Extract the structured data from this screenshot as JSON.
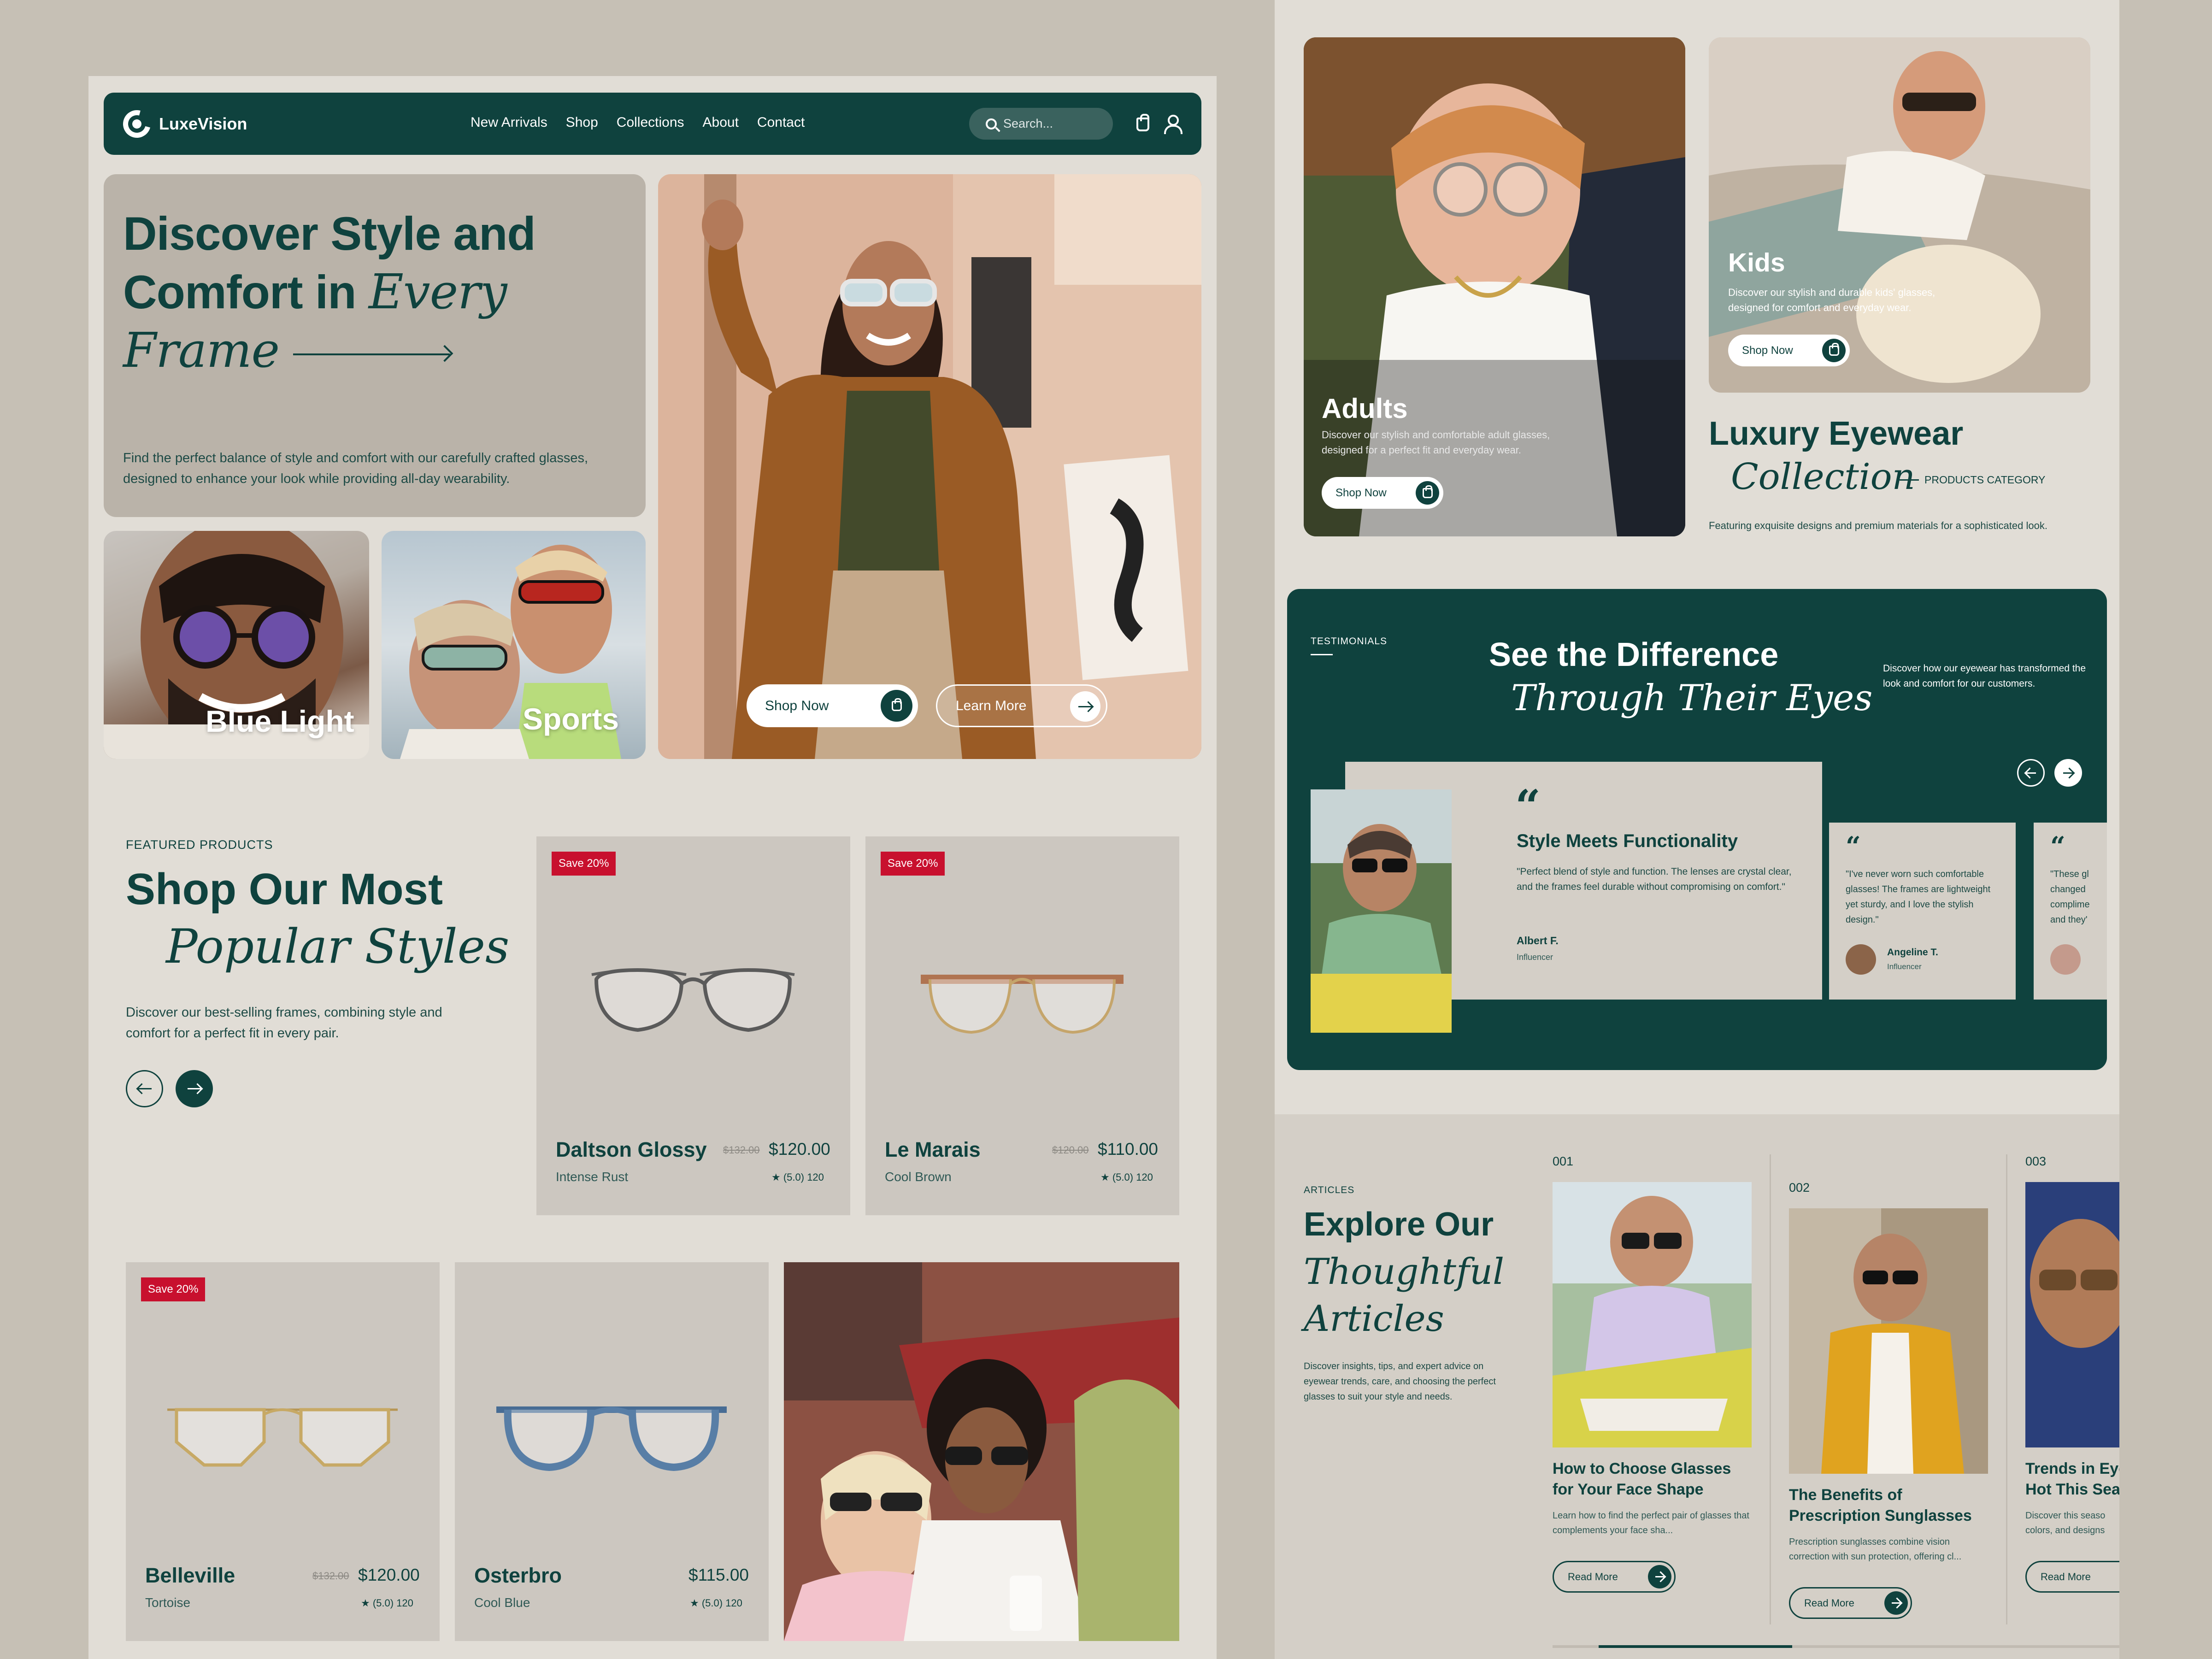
{
  "brand": {
    "name": "LuxeVision"
  },
  "nav": {
    "links": [
      "New Arrivals",
      "Shop",
      "Collections",
      "About",
      "Contact"
    ],
    "search_placeholder": "Search..."
  },
  "hero": {
    "title_line1": "Discover Style and",
    "title_line2_bold": "Comfort in",
    "title_line2_italic": "Every",
    "title_line3_italic": "Frame",
    "description": "Find the perfect balance of style and comfort with our carefully crafted glasses, designed to enhance your look while providing all-day wearability.",
    "shop_now": "Shop Now",
    "learn_more": "Learn More"
  },
  "categories": {
    "blue_light": "Blue Light",
    "sports": "Sports"
  },
  "featured": {
    "eyebrow": "FEATURED PRODUCTS",
    "title_bold": "Shop Our Most",
    "title_italic": "Popular Styles",
    "description": "Discover our best-selling frames, combining style and comfort for a perfect fit in every pair."
  },
  "products": [
    {
      "name": "Daltson Glossy",
      "color": "Intense Rust",
      "old_price": "$132.00",
      "price": "$120.00",
      "rating": "(5.0) 120",
      "badge": "Save 20%"
    },
    {
      "name": "Le Marais",
      "color": "Cool Brown",
      "old_price": "$120.00",
      "price": "$110.00",
      "rating": "(5.0) 120",
      "badge": "Save 20%"
    },
    {
      "name": "Belleville",
      "color": "Tortoise",
      "old_price": "$132.00",
      "price": "$120.00",
      "rating": "(5.0) 120",
      "badge": "Save 20%"
    },
    {
      "name": "Osterbro",
      "color": "Cool Blue",
      "old_price": "",
      "price": "$115.00",
      "rating": "(5.0) 120",
      "badge": ""
    }
  ],
  "audience": {
    "adults": {
      "title": "Adults",
      "desc": "Discover our stylish and comfortable adult glasses, designed for a perfect fit and everyday wear.",
      "cta": "Shop Now"
    },
    "kids": {
      "title": "Kids",
      "desc": "Discover our stylish and durable kids' glasses, designed for comfort and everyday wear.",
      "cta": "Shop Now"
    }
  },
  "luxury": {
    "title_bold": "Luxury Eyewear",
    "title_italic": "Collection",
    "tag": "PRODUCTS CATEGORY",
    "desc": "Featuring exquisite designs and premium materials for a sophisticated look."
  },
  "testimonials": {
    "eyebrow": "TESTIMONIALS",
    "title_bold": "See the Difference",
    "title_italic": "Through Their Eyes",
    "desc": "Discover how our eyewear has transformed the look and comfort for our customers.",
    "main": {
      "title": "Style Meets Functionality",
      "quote": "\"Perfect blend of style and function. The lenses are crystal clear, and the frames feel durable without compromising on comfort.\"",
      "author": "Albert F.",
      "role": "Influencer"
    },
    "second": {
      "quote": "\"I've never worn such comfortable glasses! The frames are lightweight yet sturdy, and I love the stylish design.\"",
      "author": "Angeline T.",
      "role": "Influencer"
    },
    "third": {
      "quote": "\"These gl changed complime and they'"
    }
  },
  "articles": {
    "eyebrow": "ARTICLES",
    "title_bold": "Explore Our",
    "title_italic_1": "Thoughtful",
    "title_italic_2": "Articles",
    "desc": "Discover insights, tips, and expert advice on eyewear trends, care, and choosing the perfect glasses to suit your style and needs.",
    "items": [
      {
        "num": "001",
        "title": "How to Choose Glasses for Your Face Shape",
        "desc": "Learn how to find the perfect pair of glasses that complements your face sha...",
        "cta": "Read More"
      },
      {
        "num": "002",
        "title": "The Benefits of Prescription Sunglasses",
        "desc": "Prescription sunglasses combine vision correction with sun protection, offering cl...",
        "cta": "Read More"
      },
      {
        "num": "003",
        "title": "Trends in Eye Hot This Seas",
        "desc": "Discover this seaso colors, and designs",
        "cta": "Read More"
      }
    ]
  },
  "colors": {
    "primary": "#0f423e",
    "accent": "#c8102e",
    "background": "#e1ddd6"
  }
}
